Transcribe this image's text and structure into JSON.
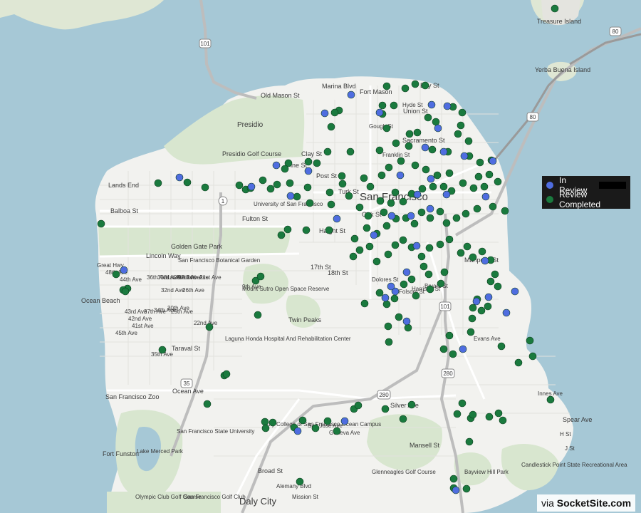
{
  "legend": {
    "items": [
      {
        "label": "In Review",
        "color": "#4f6de0"
      },
      {
        "label": "Review Completed",
        "color": "#1a7a3e"
      }
    ]
  },
  "credit": {
    "prefix": "via ",
    "site": "SocketSite.com"
  },
  "colors": {
    "water": "#a6c8d6",
    "land": "#f2f2ef",
    "park": "#d8e6cf",
    "road": "#ffffff",
    "highway": "#bdbdbd"
  },
  "places": [
    {
      "name": "Treasure Island"
    },
    {
      "name": "Yerba Buena Island"
    },
    {
      "name": "Marina Blvd"
    },
    {
      "name": "Fort Mason"
    },
    {
      "name": "Bay St"
    },
    {
      "name": "Old Mason St"
    },
    {
      "name": "Union St"
    },
    {
      "name": "Presidio"
    },
    {
      "name": "Presidio Golf Course"
    },
    {
      "name": "Clay St"
    },
    {
      "name": "Pine St"
    },
    {
      "name": "Post St"
    },
    {
      "name": "Sacramento St"
    },
    {
      "name": "Lands End"
    },
    {
      "name": "San Francisco"
    },
    {
      "name": "Turk St"
    },
    {
      "name": "Balboa St"
    },
    {
      "name": "University of San Francisco"
    },
    {
      "name": "Fulton St"
    },
    {
      "name": "Oak St"
    },
    {
      "name": "Haight St"
    },
    {
      "name": "Golden Gate Park"
    },
    {
      "name": "Lincoln Way"
    },
    {
      "name": "San Francisco Botanical Garden"
    },
    {
      "name": "17th St"
    },
    {
      "name": "18th St"
    },
    {
      "name": "Mariposa St"
    },
    {
      "name": "Great Hwy"
    },
    {
      "name": "Ocean Beach"
    },
    {
      "name": "Mount Sutro Open Space Reserve"
    },
    {
      "name": "Twin Peaks"
    },
    {
      "name": "Laguna Honda Hospital And Rehabilitation Center"
    },
    {
      "name": "Taraval St"
    },
    {
      "name": "Ocean Ave"
    },
    {
      "name": "San Francisco Zoo"
    },
    {
      "name": "San Francisco State University"
    },
    {
      "name": "Lake Merced Park"
    },
    {
      "name": "Fort Funston"
    },
    {
      "name": "City College of San Francisco Ocean Campus"
    },
    {
      "name": "Silver Ave"
    },
    {
      "name": "Mansell St"
    },
    {
      "name": "Glenneagles Golf Course"
    },
    {
      "name": "Broad St"
    },
    {
      "name": "Olympic Club Golf Course"
    },
    {
      "name": "San Francisco Golf Club"
    },
    {
      "name": "Daly City"
    },
    {
      "name": "Bayview Hill Park"
    },
    {
      "name": "Candlestick Point State Recreational Area"
    },
    {
      "name": "Spear Ave"
    },
    {
      "name": "Innes Ave"
    },
    {
      "name": "Evans Ave"
    },
    {
      "name": "Harrison St"
    },
    {
      "name": "Bryant St"
    },
    {
      "name": "Folsom St"
    },
    {
      "name": "Dolores St"
    },
    {
      "name": "Gough St"
    },
    {
      "name": "Hyde St"
    },
    {
      "name": "Franklin St"
    },
    {
      "name": "Alemany Blvd"
    },
    {
      "name": "Mission St"
    },
    {
      "name": "San Jose Ave"
    },
    {
      "name": "Geneva Ave"
    },
    {
      "name": "9th Ave"
    },
    {
      "name": "48th Ave"
    },
    {
      "name": "45th Ave"
    },
    {
      "name": "44th Ave"
    },
    {
      "name": "43rd Ave"
    },
    {
      "name": "42nd Ave"
    },
    {
      "name": "41st Ave"
    },
    {
      "name": "37th Ave"
    },
    {
      "name": "36th Ave"
    },
    {
      "name": "35th Ave"
    },
    {
      "name": "34th Ave"
    },
    {
      "name": "33rd Ave"
    },
    {
      "name": "32nd Ave"
    },
    {
      "name": "31st Ave"
    },
    {
      "name": "30th Ave"
    },
    {
      "name": "29th Ave"
    },
    {
      "name": "28th Ave"
    },
    {
      "name": "27th Ave"
    },
    {
      "name": "26th Ave"
    },
    {
      "name": "24th Ave"
    },
    {
      "name": "22nd Ave"
    },
    {
      "name": "21st Ave"
    },
    {
      "name": "H St"
    },
    {
      "name": "J St"
    },
    {
      "name": "101"
    },
    {
      "name": "80"
    },
    {
      "name": "280"
    },
    {
      "name": "1"
    },
    {
      "name": "35"
    }
  ]
}
